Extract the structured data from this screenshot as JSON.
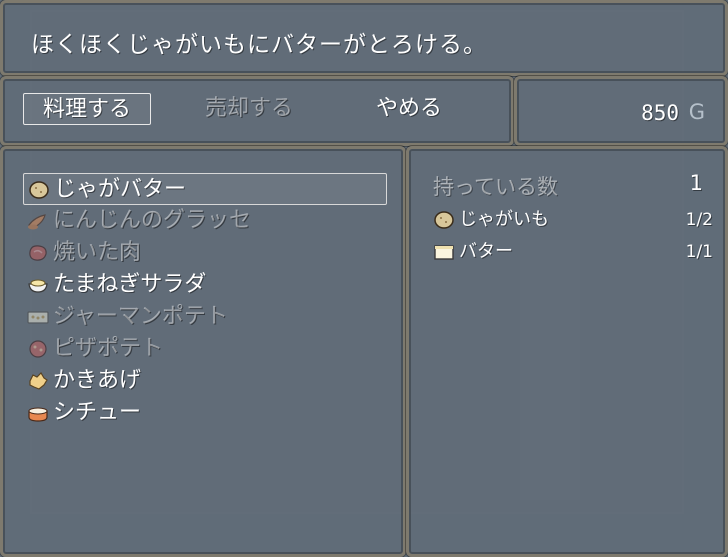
{
  "message": "ほくほくじゃがいもにバターがとろける。",
  "commands": [
    {
      "label": "料理する",
      "state": "selected"
    },
    {
      "label": "売却する",
      "state": "disabled"
    },
    {
      "label": "やめる",
      "state": "normal"
    }
  ],
  "gold": {
    "amount": "850",
    "unit": "G"
  },
  "recipes": [
    {
      "label": "じゃがバター",
      "icon": "potato-icon",
      "state": "selected"
    },
    {
      "label": "にんじんのグラッセ",
      "icon": "carrot-icon",
      "state": "disabled"
    },
    {
      "label": "焼いた肉",
      "icon": "meat-icon",
      "state": "disabled"
    },
    {
      "label": "たまねぎサラダ",
      "icon": "salad-bowl-icon",
      "state": "normal"
    },
    {
      "label": "ジャーマンポテト",
      "icon": "german-potato-icon",
      "state": "disabled"
    },
    {
      "label": "ピザポテト",
      "icon": "pizza-potato-icon",
      "state": "disabled"
    },
    {
      "label": "かきあげ",
      "icon": "kakiage-icon",
      "state": "normal"
    },
    {
      "label": "シチュー",
      "icon": "stew-icon",
      "state": "normal"
    }
  ],
  "details": {
    "owned_label": "持っている数",
    "owned_value": "1",
    "ingredients": [
      {
        "label": "じゃがいも",
        "icon": "potato-icon",
        "count": "1/2"
      },
      {
        "label": "バター",
        "icon": "butter-icon",
        "count": "1/1"
      }
    ]
  },
  "colors": {
    "window_bg": "#606c78",
    "window_border": "#7e7a6e",
    "text": "#ffffff",
    "disabled_text": "#9aa3ab"
  }
}
